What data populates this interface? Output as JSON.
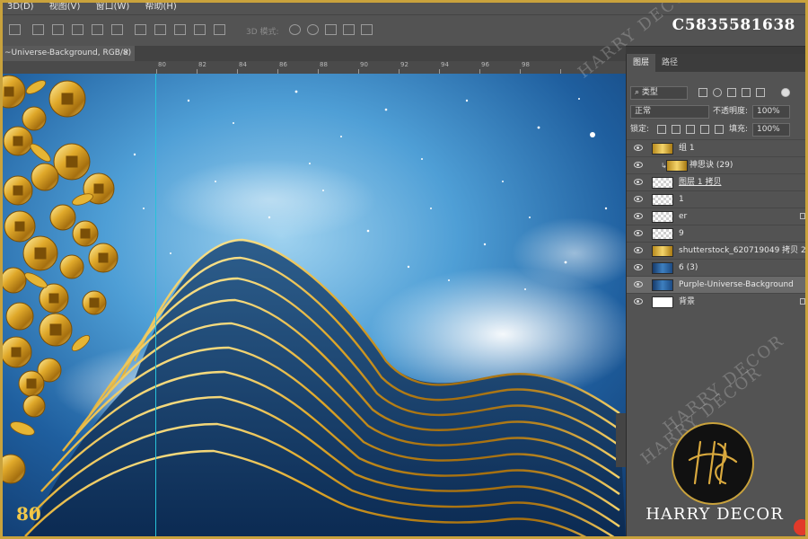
{
  "menubar": {
    "items": [
      "3D(D)",
      "视图(V)",
      "窗口(W)",
      "帮助(H)"
    ]
  },
  "optionsbar": {
    "mode_3d_label": "3D 模式:"
  },
  "doc_number": "C5835581638",
  "tab": {
    "title": "~Universe-Background, RGB/8)",
    "close": "×"
  },
  "ruler": {
    "ticks": [
      "80",
      "82",
      "84",
      "86",
      "88",
      "90",
      "92",
      "94",
      "96",
      "98"
    ]
  },
  "layers_panel": {
    "tabs": [
      "图层",
      "路径"
    ],
    "filter_label": "类型",
    "blend_mode": "正常",
    "opacity_label": "不透明度:",
    "opacity_value": "100%",
    "lock_label": "锁定:",
    "fill_label": "填充:",
    "fill_value": "100%",
    "layers": [
      {
        "name": "组 1"
      },
      {
        "name": "神思诀 (29)"
      },
      {
        "name": "图层 1 拷贝"
      },
      {
        "name": "1"
      },
      {
        "name": "er"
      },
      {
        "name": "9"
      },
      {
        "name": "shutterstock_620719049 拷贝 2"
      },
      {
        "name": "6 (3)"
      },
      {
        "name": "Purple-Universe-Background"
      },
      {
        "name": "背景"
      }
    ]
  },
  "watermark": {
    "text": "HARRY DECOR"
  },
  "brand": {
    "name": "HARRY DECOR"
  },
  "canvas_text": "80"
}
